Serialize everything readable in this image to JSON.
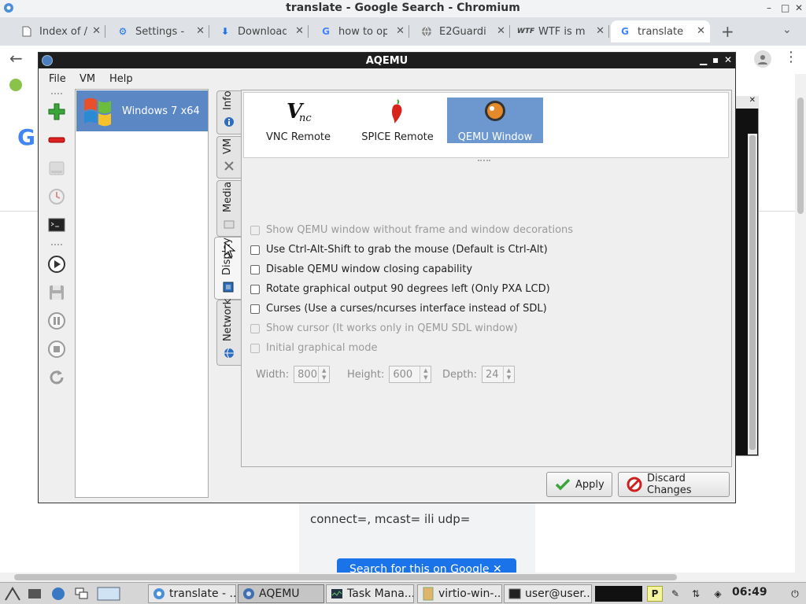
{
  "browser": {
    "title": "translate - Google Search - Chromium",
    "tabs": [
      {
        "label": "Index of /",
        "icon": "file-icon"
      },
      {
        "label": "Settings -",
        "icon": "gear-icon"
      },
      {
        "label": "Download",
        "icon": "download-icon"
      },
      {
        "label": "how to op",
        "icon": "google-icon"
      },
      {
        "label": "E2Guardi",
        "icon": "globe-icon"
      },
      {
        "label": "WTF is m",
        "icon": "wtf-icon"
      },
      {
        "label": "translate",
        "icon": "google-icon"
      }
    ],
    "new_tab": "+",
    "page": {
      "snippet": "connect=, mcast= ili udp=",
      "button": "Search for this on Google"
    }
  },
  "aqemu": {
    "title": "AQEMU",
    "menu": [
      {
        "label": "File",
        "mnemonic": "F"
      },
      {
        "label": "VM",
        "mnemonic": "V"
      },
      {
        "label": "Help",
        "mnemonic": "H"
      }
    ],
    "vm_list": [
      {
        "name": "Windows 7 x64",
        "selected": true
      }
    ],
    "tabs": [
      {
        "label": "Info",
        "active": false
      },
      {
        "label": "VM",
        "active": false
      },
      {
        "label": "Media",
        "active": false
      },
      {
        "label": "Display",
        "active": true
      },
      {
        "label": "Network",
        "active": false
      }
    ],
    "display_modes": [
      {
        "label": "VNC Remote",
        "icon": "vnc-icon",
        "active": false
      },
      {
        "label": "SPICE Remote",
        "icon": "spice-pepper-icon",
        "active": false
      },
      {
        "label": "QEMU Window",
        "icon": "qemu-icon",
        "active": true
      }
    ],
    "options": [
      {
        "label": "Show QEMU window without frame and window decorations",
        "checked": false,
        "enabled": false
      },
      {
        "label": "Use Ctrl-Alt-Shift to grab the mouse (Default is Ctrl-Alt)",
        "checked": false,
        "enabled": true
      },
      {
        "label": "Disable QEMU window closing capability",
        "checked": false,
        "enabled": true
      },
      {
        "label": "Rotate graphical output 90 degrees left (Only PXA LCD)",
        "checked": false,
        "enabled": true
      },
      {
        "label": "Curses (Use a curses/ncurses interface instead of SDL)",
        "checked": false,
        "enabled": true
      },
      {
        "label": "Show cursor (It works only in QEMU SDL window)",
        "checked": false,
        "enabled": false
      },
      {
        "label": "Initial graphical mode",
        "checked": false,
        "enabled": false
      }
    ],
    "resolution": {
      "width_label": "Width:",
      "width": "800",
      "height_label": "Height:",
      "height": "600",
      "depth_label": "Depth:",
      "depth": "24"
    },
    "buttons": {
      "apply": "Apply",
      "discard": "Discard Changes"
    }
  },
  "taskbar": {
    "tasks": [
      {
        "label": "translate - ...",
        "icon": "chromium-icon",
        "active": false
      },
      {
        "label": "AQEMU",
        "icon": "aqemu-icon",
        "active": true
      },
      {
        "label": "Task Mana...",
        "icon": "task-manager-icon",
        "active": false
      },
      {
        "label": "virtio-win-...",
        "icon": "folder-icon",
        "active": false
      },
      {
        "label": "user@user...",
        "icon": "terminal-icon",
        "active": false
      }
    ],
    "clock": "06:49"
  }
}
